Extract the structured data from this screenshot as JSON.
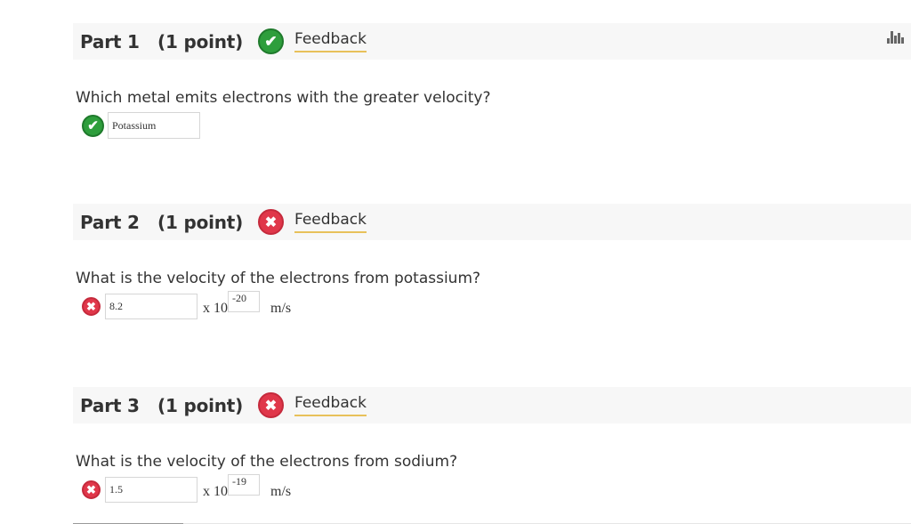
{
  "parts": [
    {
      "title": "Part 1",
      "points": "(1 point)",
      "feedback_label": "Feedback",
      "status": "correct",
      "question": "Which metal emits electrons with the greater velocity?",
      "answer": "Potassium"
    },
    {
      "title": "Part 2",
      "points": "(1 point)",
      "feedback_label": "Feedback",
      "status": "incorrect",
      "question": "What is the velocity of the electrons from potassium?",
      "mantissa": "8.2",
      "times": "x 10",
      "exponent": "-20",
      "unit": "m/s"
    },
    {
      "title": "Part 3",
      "points": "(1 point)",
      "feedback_label": "Feedback",
      "status": "incorrect",
      "question": "What is the velocity of the electrons from sodium?",
      "mantissa": "1.5",
      "times": "x 10",
      "exponent": "-19",
      "unit": "m/s"
    }
  ],
  "icons": {
    "correct": "✔",
    "incorrect": "✖",
    "stats": "stats-icon"
  },
  "colors": {
    "correct": "#2e9e3c",
    "incorrect": "#e0374a",
    "feedback_underline": "#e8c15a"
  }
}
